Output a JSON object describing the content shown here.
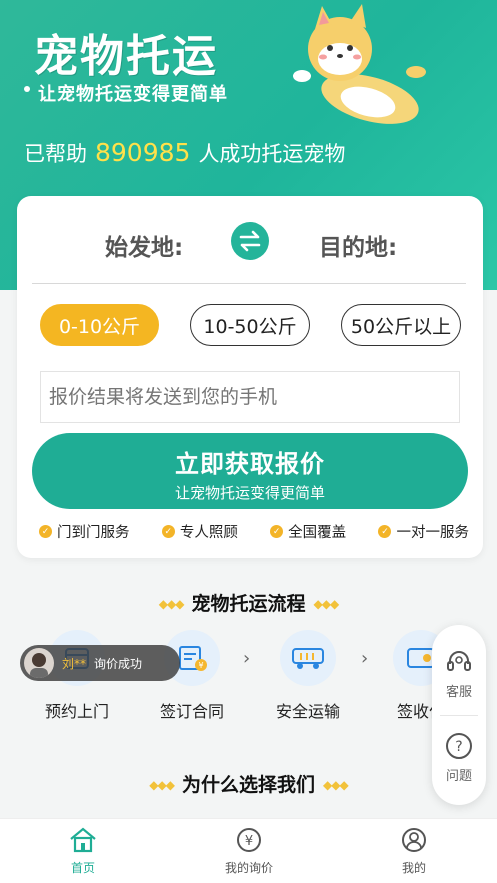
{
  "hero": {
    "title": "宠物托运",
    "subtitle": "让宠物托运变得更简单",
    "helped_prefix": "已帮助",
    "helped_count": "890985",
    "helped_suffix": "人成功托运宠物"
  },
  "route": {
    "origin_label": "始发地:",
    "destination_label": "目的地:"
  },
  "weights": [
    {
      "label": "0-10公斤",
      "selected": true
    },
    {
      "label": "10-50公斤",
      "selected": false
    },
    {
      "label": "50公斤以上",
      "selected": false
    }
  ],
  "phone_input": {
    "placeholder": "报价结果将发送到您的手机",
    "value": ""
  },
  "cta": {
    "label": "立即获取报价",
    "sub": "让宠物托运变得更简单"
  },
  "features": [
    "门到门服务",
    "专人照顾",
    "全国覆盖",
    "一对一服务"
  ],
  "process": {
    "title": "宠物托运流程",
    "steps": [
      "预约上门",
      "签订合同",
      "安全运输",
      "签收付"
    ]
  },
  "toast": {
    "name": "刘**",
    "message": "询价成功"
  },
  "why": {
    "title": "为什么选择我们"
  },
  "side_buttons": {
    "service": "客服",
    "faq": "问题"
  },
  "tabs": [
    {
      "label": "首页",
      "icon": "home-icon",
      "active": true
    },
    {
      "label": "我的询价",
      "icon": "yuan-icon",
      "active": false
    },
    {
      "label": "我的",
      "icon": "user-icon",
      "active": false
    }
  ],
  "colors": {
    "primary": "#1fad95",
    "accent": "#f4b622",
    "count_highlight": "#ffe14a"
  }
}
